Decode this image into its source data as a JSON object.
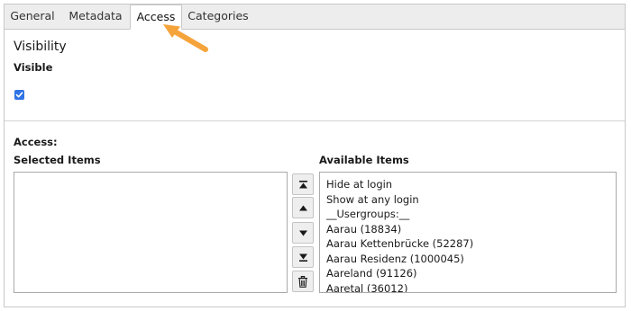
{
  "tabs": [
    {
      "label": "General"
    },
    {
      "label": "Metadata"
    },
    {
      "label": "Access",
      "active": true
    },
    {
      "label": "Categories"
    }
  ],
  "visibility": {
    "title": "Visibility",
    "field_label": "Visible",
    "checked": true
  },
  "access": {
    "label": "Access:",
    "selected_header": "Selected Items",
    "available_header": "Available Items",
    "selected_items": [],
    "available_items": [
      "Hide at login",
      "Show at any login",
      "__Usergroups:__",
      "Aarau (18834)",
      "Aarau Kettenbrücke (52287)",
      "Aarau Residenz (1000045)",
      "Aareland (91126)",
      "Aaretal (36012)"
    ]
  },
  "buttons": {
    "move_top": "move-to-top-icon",
    "move_up": "move-up-icon",
    "move_down": "move-down-icon",
    "move_bottom": "move-to-bottom-icon",
    "remove": "trash-icon"
  },
  "colors": {
    "accent_arrow": "#f5a33b",
    "checkbox": "#2f73e5",
    "tabbar_bg": "#ededed"
  }
}
